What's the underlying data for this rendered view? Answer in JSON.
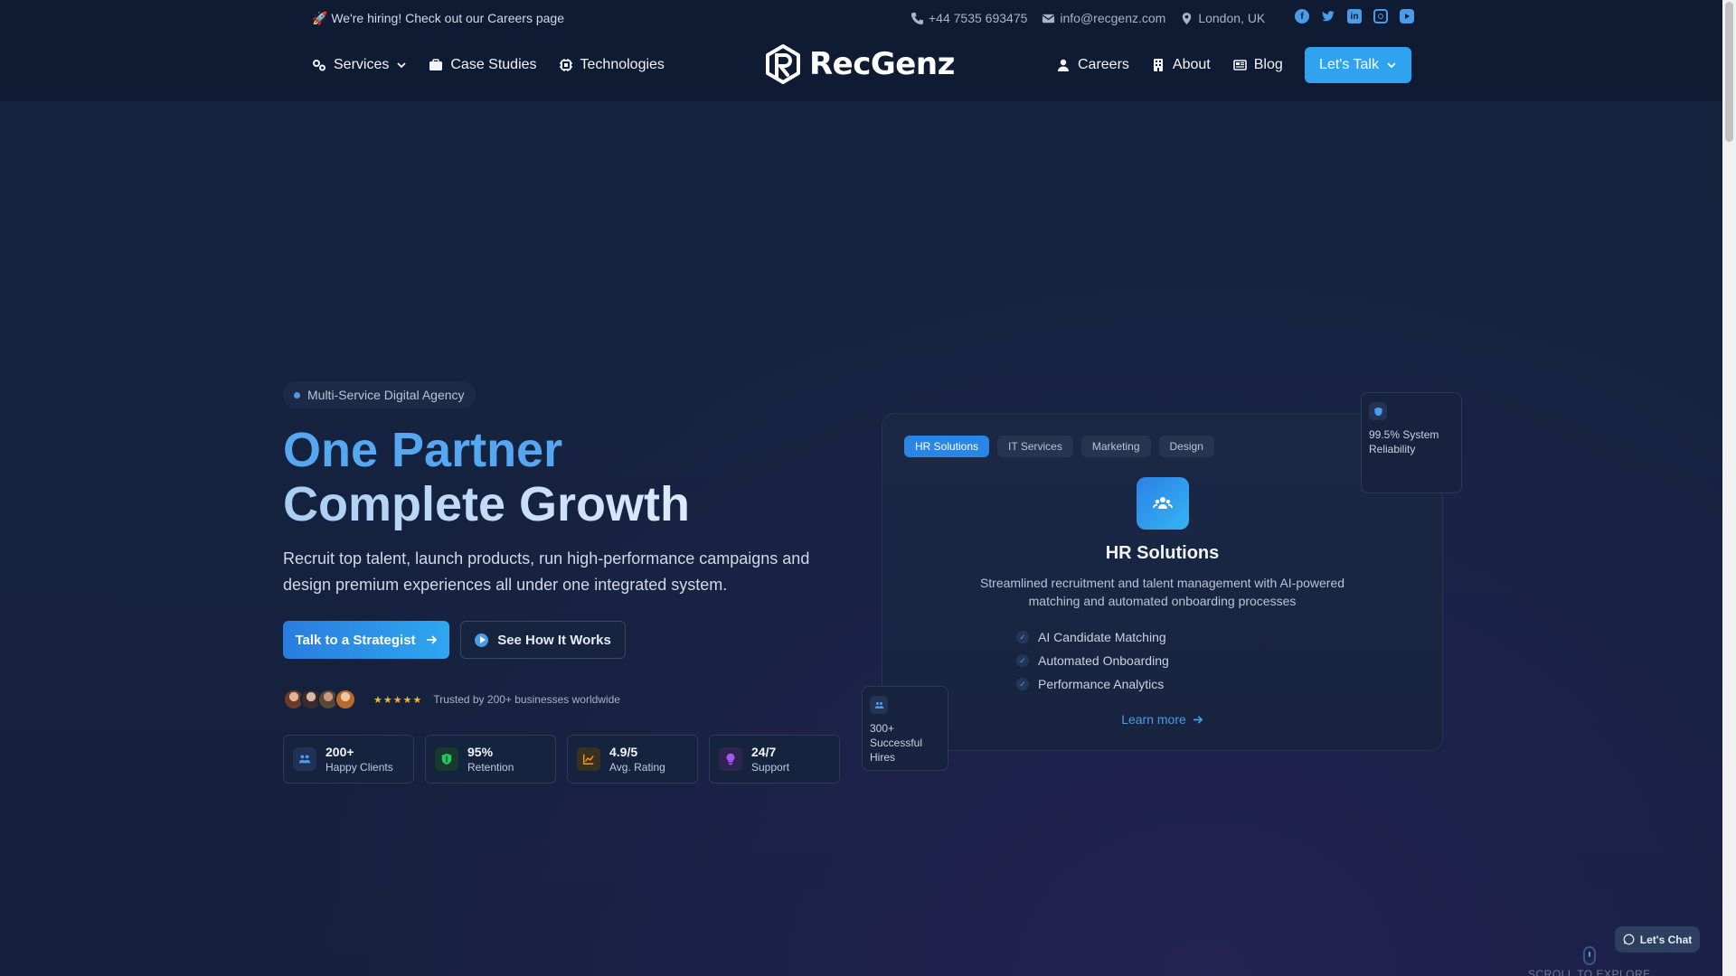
{
  "topbar": {
    "hiring_text": "🚀 We're hiring! Check out our Careers page",
    "phone": "+44 7535 693475",
    "email": "info@recgenz.com",
    "location": "London, UK",
    "social_icons": [
      "facebook-icon",
      "twitter-icon",
      "linkedin-icon",
      "instagram-icon",
      "youtube-icon"
    ]
  },
  "nav": {
    "left": [
      {
        "label": "Services",
        "icon": "gears-icon"
      },
      {
        "label": "Case Studies",
        "icon": "briefcase-icon"
      },
      {
        "label": "Technologies",
        "icon": "chip-icon"
      }
    ],
    "logo_text": "RecGenz",
    "right": [
      {
        "label": "Careers",
        "icon": "user-icon"
      },
      {
        "label": "About",
        "icon": "building-icon"
      },
      {
        "label": "Blog",
        "icon": "newspaper-icon"
      }
    ],
    "cta_label": "Let's Talk"
  },
  "hero": {
    "badge": "Multi-Service Digital Agency",
    "title_line1": "One Partner",
    "title_line2": "Complete Growth",
    "subtitle": "Recruit top talent, launch products, run high-performance campaigns and design premium experiences all under one integrated system.",
    "primary_button": "Talk to a Strategist",
    "secondary_button": "See How It Works",
    "stars": "★★★★★",
    "trust_text": "Trusted by 200+ businesses worldwide",
    "stats": [
      {
        "value": "200+",
        "label": "Happy Clients",
        "icon": "users-icon",
        "color": "#4a9be8"
      },
      {
        "value": "95%",
        "label": "Retention",
        "icon": "shield-icon",
        "color": "#22c55e"
      },
      {
        "value": "4.9/5",
        "label": "Avg. Rating",
        "icon": "chart-icon",
        "color": "#f59e0b"
      },
      {
        "value": "24/7",
        "label": "Support",
        "icon": "bulb-icon",
        "color": "#a855f7"
      }
    ]
  },
  "card": {
    "tabs": [
      "HR Solutions",
      "IT Services",
      "Marketing",
      "Design"
    ],
    "active_tab": "HR Solutions",
    "title": "HR Solutions",
    "description": "Streamlined recruitment and talent management with AI-powered matching and automated onboarding processes",
    "features": [
      "AI Candidate Matching",
      "Automated Onboarding",
      "Performance Analytics"
    ],
    "learn_more": "Learn more",
    "float_reliability": "99.5% System Reliability",
    "float_hires": "300+ Successful Hires"
  },
  "footer": {
    "scroll_text": "SCROLL TO EXPLORE",
    "chat_label": "Let's Chat"
  },
  "colors": {
    "accent": "#2fa3f0",
    "background": "#13223e"
  }
}
